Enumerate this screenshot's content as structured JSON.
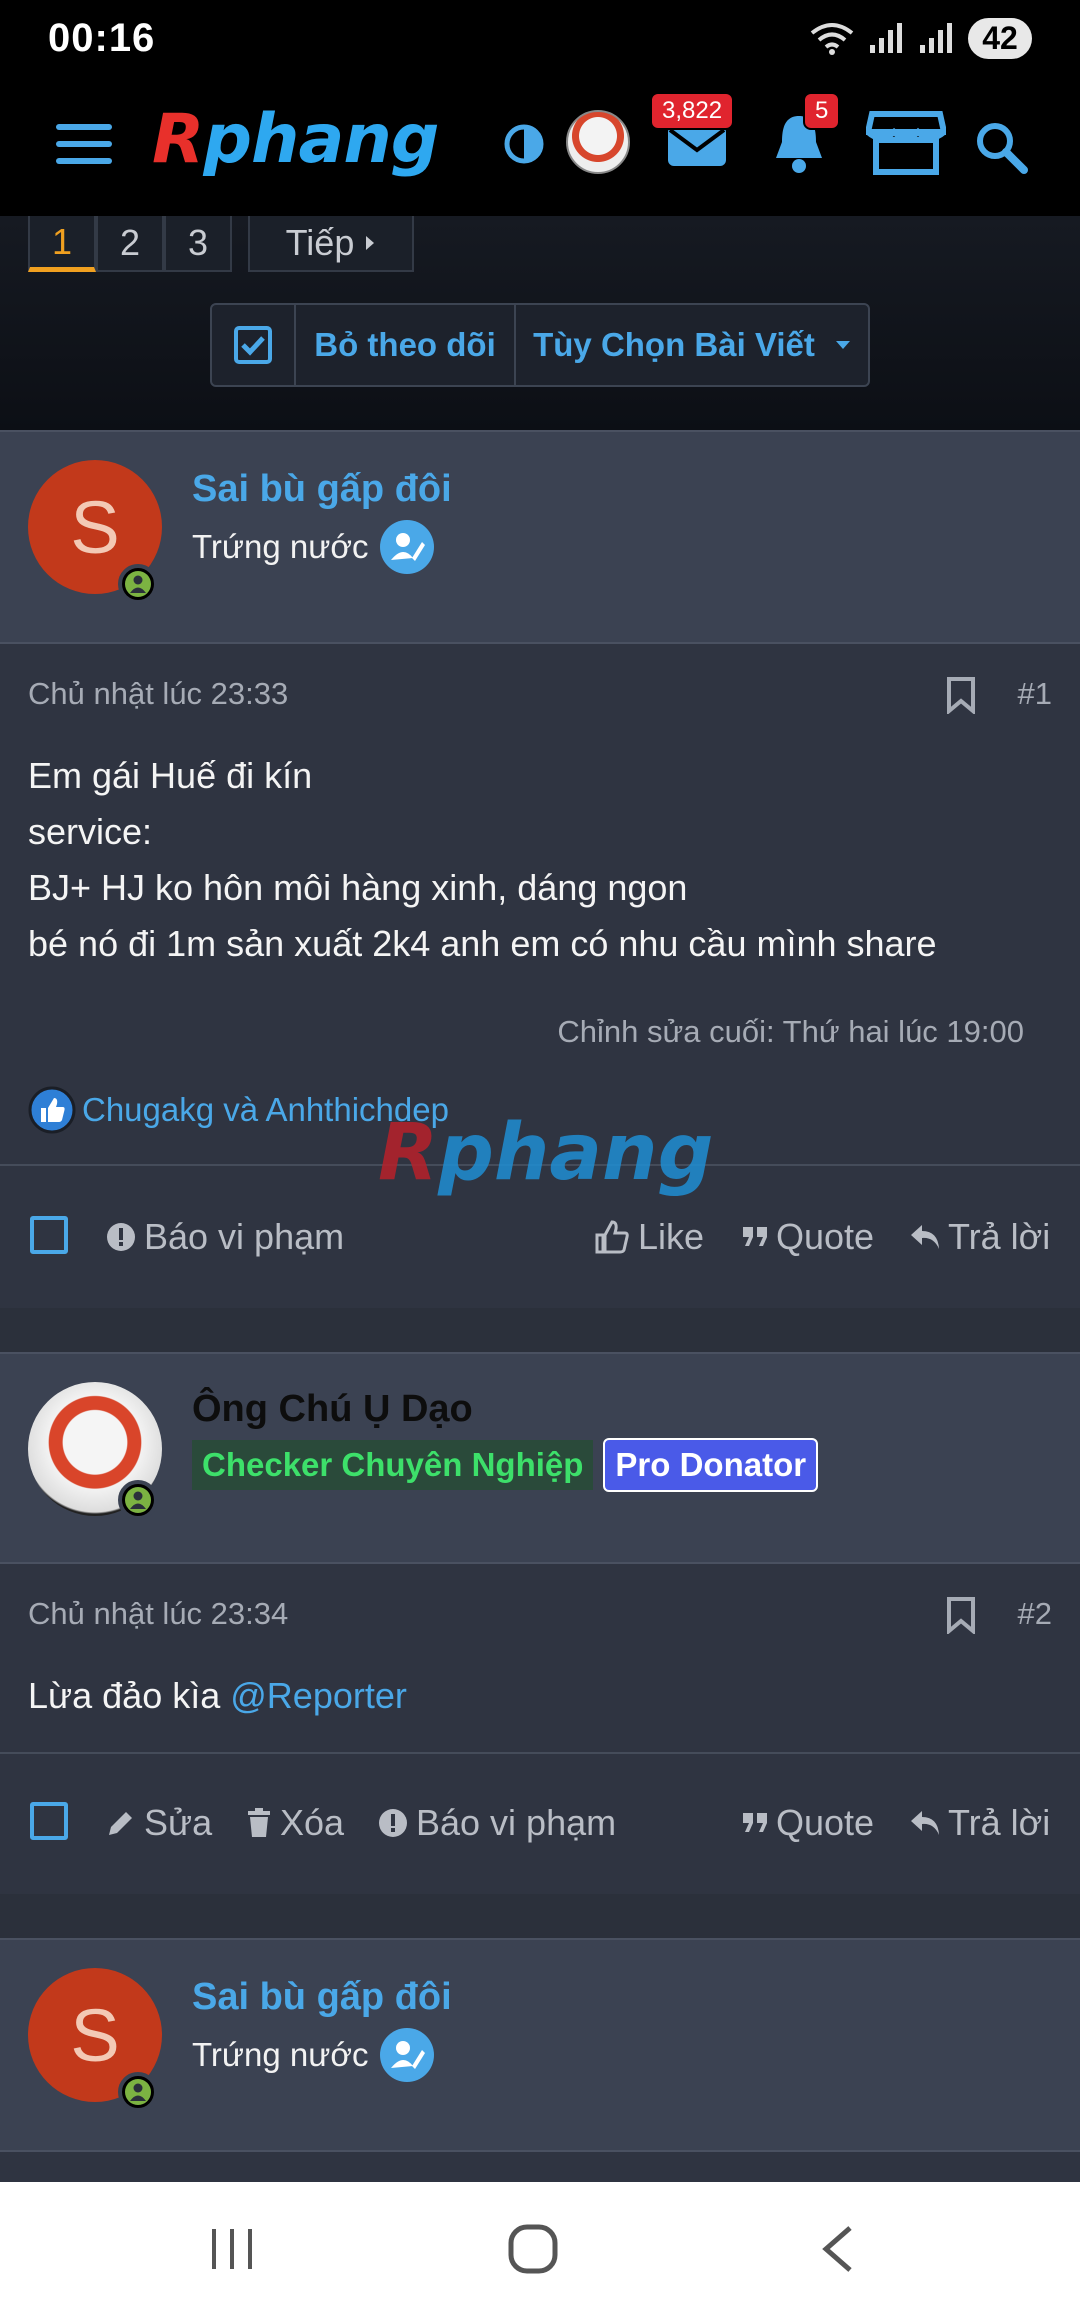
{
  "status_bar": {
    "time": "00:16",
    "battery": "42",
    "icons": [
      "wifi-icon",
      "signal-icon",
      "signal-icon"
    ]
  },
  "header": {
    "logo": "Rphang",
    "messages_count": "3,822",
    "alerts_count": "5"
  },
  "pagination": {
    "pages": [
      "1",
      "2",
      "3"
    ],
    "active_page": "1",
    "next_label": "Tiếp"
  },
  "thread_toolbar": {
    "unwatch_label": "Bỏ theo dõi",
    "options_label": "Tùy Chọn Bài Viết"
  },
  "posts": [
    {
      "author": "Sai bù gấp đôi",
      "avatar_letter": "S",
      "user_title": "Trứng nước",
      "date": "Chủ nhật lúc 23:33",
      "number": "#1",
      "lines": [
        "Em gái Huế đi kín",
        "service:",
        "BJ+ HJ ko hôn môi hàng xinh, dáng ngon",
        "bé nó đi 1m sản xuất 2k4 anh em có nhu cầu mình share"
      ],
      "edited": "Chỉnh sửa cuối: Thứ hai lúc 19:00",
      "reactions": "Chugakg và Anhthichdep",
      "actions": {
        "report": "Báo vi phạm",
        "like": "Like",
        "quote": "Quote",
        "reply": "Trả lời"
      }
    },
    {
      "author": "Ông Chú Ụ Dạo",
      "tags": [
        "Checker Chuyên Nghiệp",
        "Pro Donator"
      ],
      "date": "Chủ nhật lúc 23:34",
      "number": "#2",
      "text_prefix": "Lừa đảo kìa ",
      "mention": "@Reporter",
      "actions": {
        "edit": "Sửa",
        "delete": "Xóa",
        "report": "Báo vi phạm",
        "quote": "Quote",
        "reply": "Trả lời"
      }
    },
    {
      "author": "Sai bù gấp đôi",
      "avatar_letter": "S",
      "user_title": "Trứng nước"
    }
  ],
  "watermark": "Rphang",
  "colors": {
    "accent": "#4aa8e8",
    "badge": "#e0242e",
    "active_page": "#f0a020"
  }
}
